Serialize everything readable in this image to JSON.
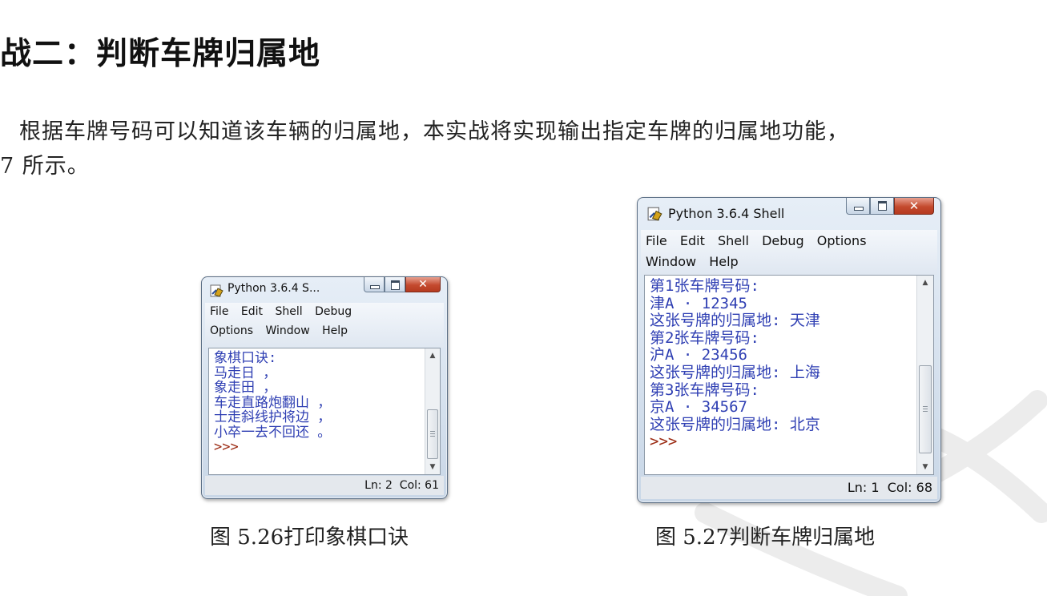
{
  "heading": "战二：判断车牌归属地",
  "paragraph": {
    "line1": "根据车牌号码可以知道该车辆的归属地，本实战将实现输出指定车牌的归属地功能，",
    "line2": "7 所示。"
  },
  "windows": [
    {
      "title": "Python 3.6.4 S...",
      "menu_row1": [
        "File",
        "Edit",
        "Shell",
        "Debug"
      ],
      "menu_row2": [
        "Options",
        "Window",
        "Help"
      ],
      "output_lines": [
        "象棋口诀:",
        "马走日 ，",
        "象走田 ，",
        "车走直路炮翻山 ，",
        "士走斜线护将边 ，",
        "小卒一去不回还 。"
      ],
      "prompt": ">>>",
      "status": "Ln: 2  Col: 61",
      "caption": {
        "number": "图 5.26",
        "text": "打印象棋口诀"
      }
    },
    {
      "title": "Python 3.6.4 Shell",
      "menu_row1": [
        "File",
        "Edit",
        "Shell",
        "Debug",
        "Options"
      ],
      "menu_row2": [
        "Window",
        "Help"
      ],
      "output_lines": [
        "第1张车牌号码:",
        "津A · 12345",
        "这张号牌的归属地: 天津",
        "第2张车牌号码:",
        "沪A · 23456",
        "这张号牌的归属地: 上海",
        "第3张车牌号码:",
        "京A · 34567",
        "这张号牌的归属地: 北京"
      ],
      "prompt": ">>>",
      "status": "Ln: 1  Col: 68",
      "caption": {
        "number": "图 5.27",
        "text": "判断车牌归属地"
      }
    }
  ],
  "colors": {
    "shell_output": "#2f3fb3",
    "shell_prompt": "#9b2a12",
    "close_button": "#c44a2e"
  }
}
